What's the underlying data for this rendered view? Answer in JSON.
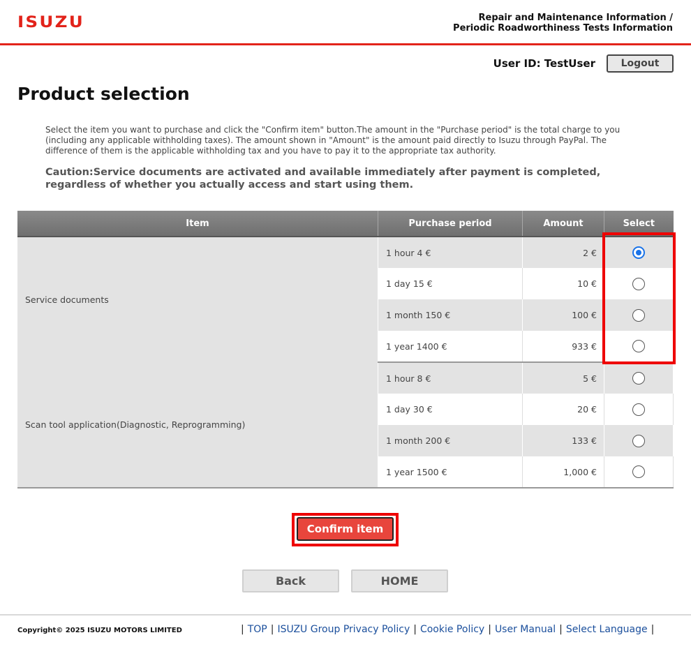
{
  "header": {
    "logo_text": "ISUZU",
    "title_line1": "Repair and Maintenance Information /",
    "title_line2": "Periodic Roadworthiness Tests Information",
    "user_text": "User ID: TestUser",
    "logout_label": "Logout"
  },
  "page": {
    "title": "Product selection",
    "intro": "Select the item you want to purchase and click the \"Confirm item\" button.The amount in the \"Purchase period\" is the total charge to you (including any applicable withholding taxes). The amount shown in \"Amount\" is the amount paid directly to Isuzu through PayPal. The difference of them is the applicable withholding tax and you have to pay it to the appropriate tax authority.",
    "caution": "Caution:Service documents are activated and available immediately after payment is completed, regardless of whether you actually access and start using them."
  },
  "table": {
    "headers": [
      "Item",
      "Purchase period",
      "Amount",
      "Select"
    ],
    "groups": [
      {
        "item": "Service documents",
        "rows": [
          {
            "period": "1 hour 4 €",
            "amount": "2 €",
            "selected": true
          },
          {
            "period": "1 day 15 €",
            "amount": "10 €",
            "selected": false
          },
          {
            "period": "1 month 150 €",
            "amount": "100 €",
            "selected": false
          },
          {
            "period": "1 year 1400 €",
            "amount": "933 €",
            "selected": false
          }
        ]
      },
      {
        "item": "Scan tool application(Diagnostic, Reprogramming)",
        "rows": [
          {
            "period": "1 hour 8 €",
            "amount": "5 €",
            "selected": false
          },
          {
            "period": "1 day 30 €",
            "amount": "20 €",
            "selected": false
          },
          {
            "period": "1 month 200 €",
            "amount": "133 €",
            "selected": false
          },
          {
            "period": "1 year 1500 €",
            "amount": "1,000 €",
            "selected": false
          }
        ]
      }
    ]
  },
  "buttons": {
    "confirm_label": "Confirm item",
    "back_label": "Back",
    "home_label": "HOME"
  },
  "footer": {
    "copyright": "Copyright© 2025 ISUZU MOTORS LIMITED",
    "links": [
      "TOP",
      "ISUZU Group Privacy Policy",
      "Cookie Policy",
      "User Manual",
      "Select Language"
    ]
  },
  "colors": {
    "brand_red": "#e2231a",
    "highlight_red": "#ee0000",
    "confirm_red": "#e8453c",
    "radio_blue": "#1a73e8"
  }
}
